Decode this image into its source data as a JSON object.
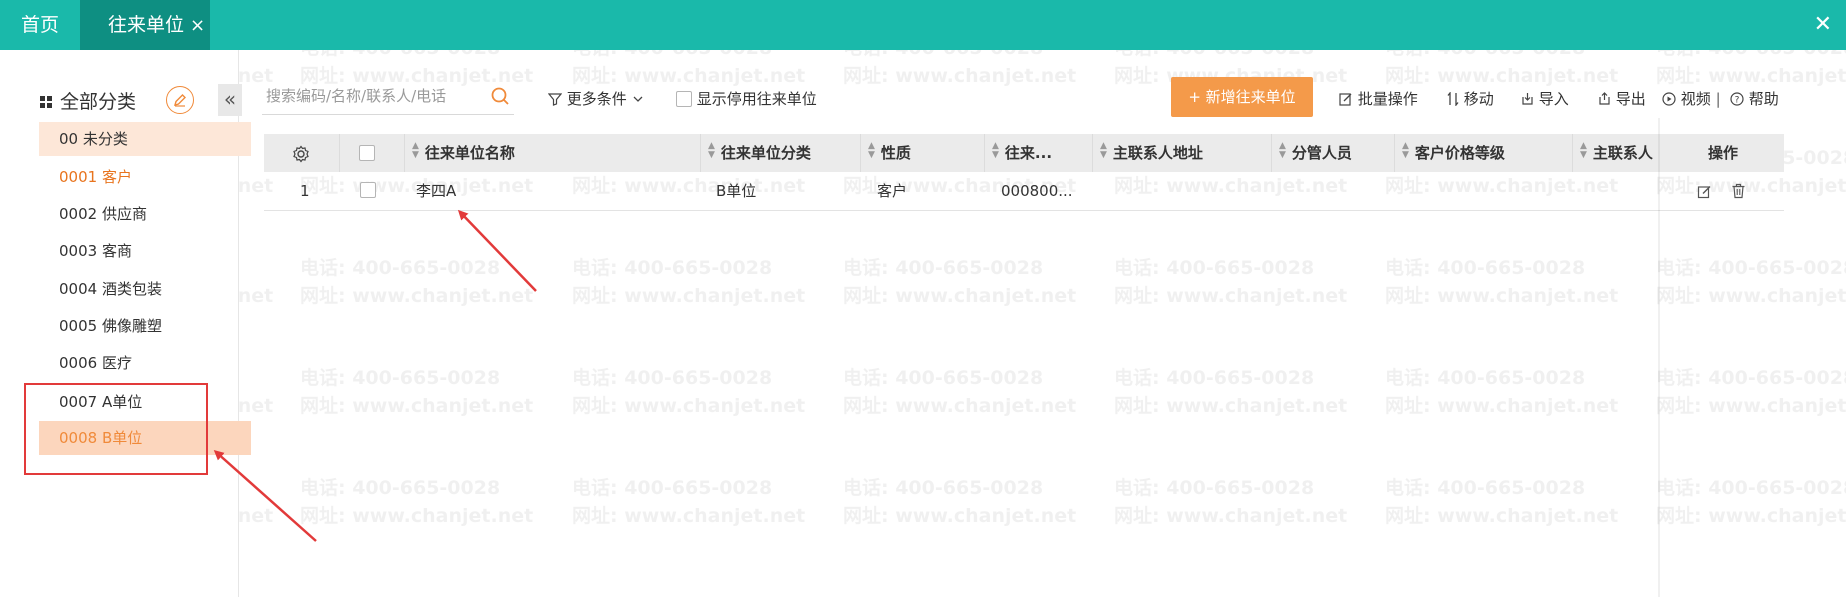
{
  "tabs": {
    "home": "首页",
    "active": "往来单位",
    "active_close": "×",
    "window_close": "✕"
  },
  "watermark": {
    "phone": "电话: 400-665-0028",
    "site": "网址: www.chanjet.net"
  },
  "sidebar": {
    "title": "全部分类",
    "collapse": "«",
    "items": [
      {
        "label": "00 未分类"
      },
      {
        "label": "0001 客户"
      },
      {
        "label": "0002 供应商"
      },
      {
        "label": "0003 客商"
      },
      {
        "label": "0004 酒类包装"
      },
      {
        "label": "0005 佛像雕塑"
      },
      {
        "label": "0006 医疗"
      },
      {
        "label": "0007 A单位"
      },
      {
        "label": "0008 B单位"
      }
    ],
    "selected_index": 8
  },
  "toolbar": {
    "search_placeholder": "搜索编码/名称/联系人/电话",
    "more_conditions": "更多条件",
    "show_disabled": "显示停用往来单位",
    "add_button": "新增往来单位",
    "batch": "批量操作",
    "move": "移动",
    "import": "导入",
    "export": "导出",
    "video": "视频",
    "separator": "|",
    "help": "帮助"
  },
  "table": {
    "columns": [
      "往来单位名称",
      "往来单位分类",
      "性质",
      "往来...",
      "主联系人地址",
      "分管人员",
      "客户价格等级",
      "主联系人",
      "操作"
    ],
    "rows": [
      {
        "index": "1",
        "name": "李四A",
        "category": "B单位",
        "nature": "客户",
        "code": "000800..."
      }
    ]
  },
  "colors": {
    "topbar": "#1ab9aa",
    "active_tab": "#0e8f82",
    "accent": "#f49a4a",
    "annotation": "#e23a3a"
  }
}
